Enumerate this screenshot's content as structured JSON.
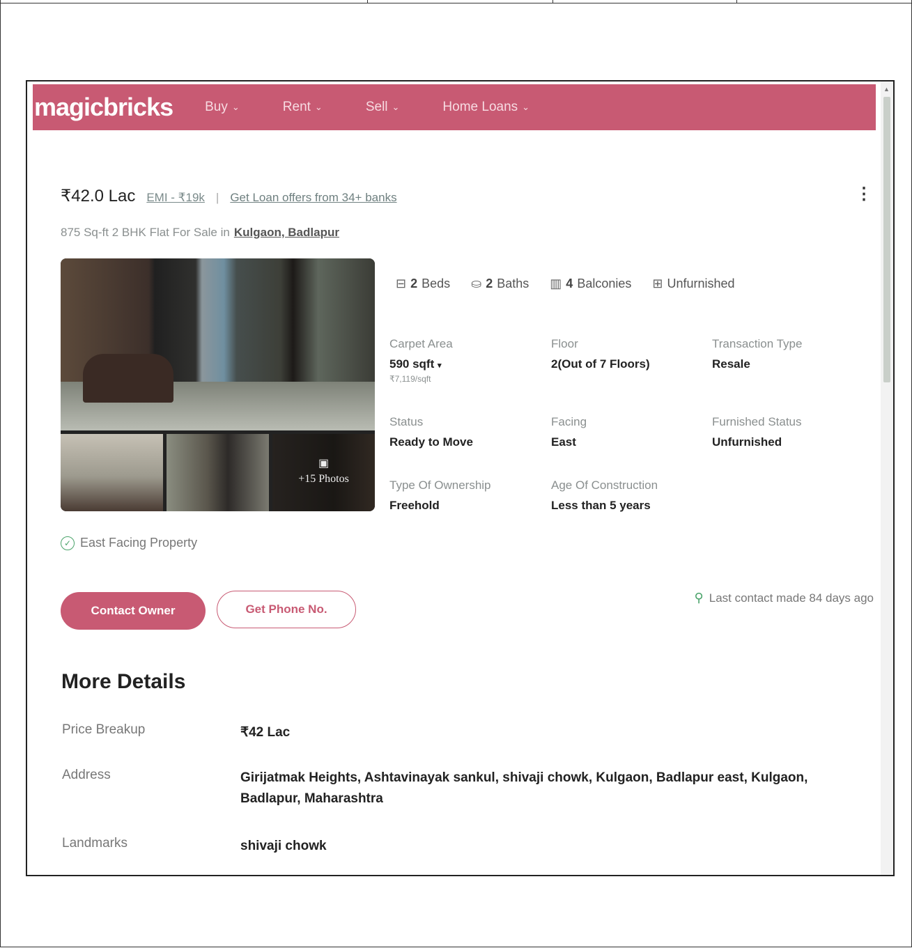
{
  "nav": {
    "logo": "magicbricks",
    "items": [
      {
        "label": "Buy"
      },
      {
        "label": "Rent"
      },
      {
        "label": "Sell"
      },
      {
        "label": "Home Loans"
      }
    ]
  },
  "listing": {
    "price": "₹42.0 Lac",
    "emi": "EMI - ₹19k",
    "separator": "|",
    "loan_link": "Get Loan offers from 34+ banks",
    "subtitle": "875 Sq-ft 2 BHK Flat For Sale in",
    "location": "Kulgaon, Badlapur",
    "photos_more": "+15 Photos"
  },
  "amenities": [
    {
      "icon": "bed-icon",
      "count": "2",
      "label": "Beds"
    },
    {
      "icon": "bath-icon",
      "count": "2",
      "label": "Baths"
    },
    {
      "icon": "balcony-icon",
      "count": "4",
      "label": "Balconies"
    },
    {
      "icon": "furnish-icon",
      "count": "",
      "label": "Unfurnished"
    }
  ],
  "facts": [
    {
      "label": "Carpet Area",
      "value": "590 sqft",
      "sub": "₹7,119/sqft"
    },
    {
      "label": "Floor",
      "value": "2(Out of 7 Floors)"
    },
    {
      "label": "Transaction Type",
      "value": "Resale"
    },
    {
      "label": "Status",
      "value": "Ready to Move"
    },
    {
      "label": "Facing",
      "value": "East"
    },
    {
      "label": "Furnished Status",
      "value": "Unfurnished"
    },
    {
      "label": "Type Of Ownership",
      "value": "Freehold"
    },
    {
      "label": "Age Of Construction",
      "value": "Less than 5 years"
    }
  ],
  "feature": "East Facing Property",
  "actions": {
    "contact_owner": "Contact Owner",
    "get_phone": "Get Phone No.",
    "last_contact": "Last contact made 84 days ago"
  },
  "more_details": {
    "title": "More Details",
    "rows": [
      {
        "label": "Price Breakup",
        "value": "₹42 Lac"
      },
      {
        "label": "Address",
        "value": "Girijatmak Heights, Ashtavinayak sankul, shivaji chowk, Kulgaon, Badlapur east, Kulgaon, Badlapur, Maharashtra"
      },
      {
        "label": "Landmarks",
        "value": "shivaji chowk"
      }
    ]
  },
  "colors": {
    "brand": "#c85a73",
    "check": "#4aa36a"
  }
}
